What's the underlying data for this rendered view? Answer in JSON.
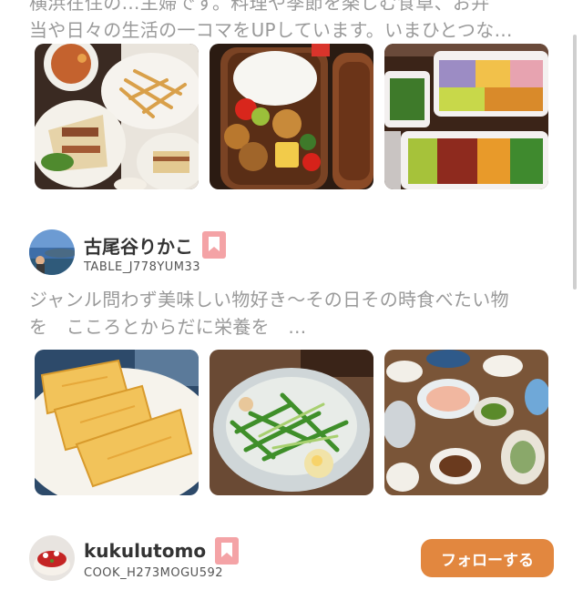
{
  "colors": {
    "follow_button": "#e2873f",
    "bookmark_badge": "#f4a3a6",
    "bio_text": "#9a9a9a"
  },
  "top_user": {
    "bio_lines": [
      "横浜在住の…主婦です。料理や季節を楽しむ食卓、お弁",
      "当や日々の生活の一コマをUPしています。いまひとつな…"
    ]
  },
  "users": [
    {
      "display_name": "古尾谷りかこ",
      "user_id": "TABLE_J778YUM33",
      "avatar_icon": "avatar-landscape-photo",
      "bio_lines": [
        "ジャンル問わず美味しい物好き～その日その時食べたい物",
        "を　こころとからだに栄養を　…"
      ]
    },
    {
      "display_name": "kukulutomo",
      "user_id": "COOK_H273MOGU592",
      "avatar_icon": "avatar-cake-photo",
      "follow_label": "フォローする"
    }
  ],
  "photos_row_1": [
    "food-photo-curry-fries-sandwich",
    "food-photo-bento-box",
    "food-photo-bento-containers"
  ],
  "photos_row_2": [
    "food-photo-spring-rolls",
    "food-photo-cucumber-salad",
    "food-photo-dinner-table"
  ]
}
